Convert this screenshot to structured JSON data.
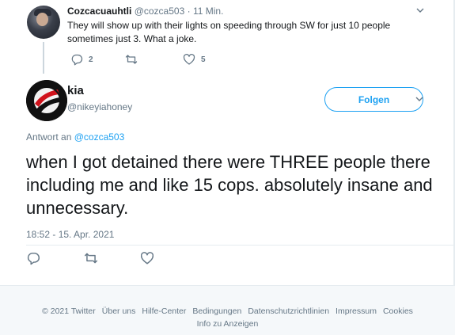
{
  "parent_tweet": {
    "name": "Cozcacuauhtli",
    "handle": "@cozca503",
    "separator": "·",
    "time": "11 Min.",
    "text": "They will show up with their lights on speeding through SW for just 10 people sometimes just 3.  What a joke.",
    "reply_count": "2",
    "retweet_count": "",
    "like_count": "5"
  },
  "main_tweet": {
    "name": "kia",
    "handle": "@nikeyiahoney",
    "follow_label": "Folgen",
    "reply_prefix": "Antwort an",
    "reply_mention": "@cozca503",
    "text": "when I got detained there were THREE people there including me and like 15 cops. absolutely insane and unnecessary.",
    "timestamp": "18:52 - 15. Apr. 2021"
  },
  "footer": {
    "links": [
      "© 2021 Twitter",
      "Über uns",
      "Hilfe-Center",
      "Bedingungen",
      "Datenschutzrichtlinien",
      "Impressum",
      "Cookies",
      "Info zu Anzeigen"
    ]
  },
  "colors": {
    "accent": "#1da1f2",
    "secondary_text": "#657786",
    "primary_text": "#14171a",
    "footer_bg": "#f5f8fa"
  }
}
